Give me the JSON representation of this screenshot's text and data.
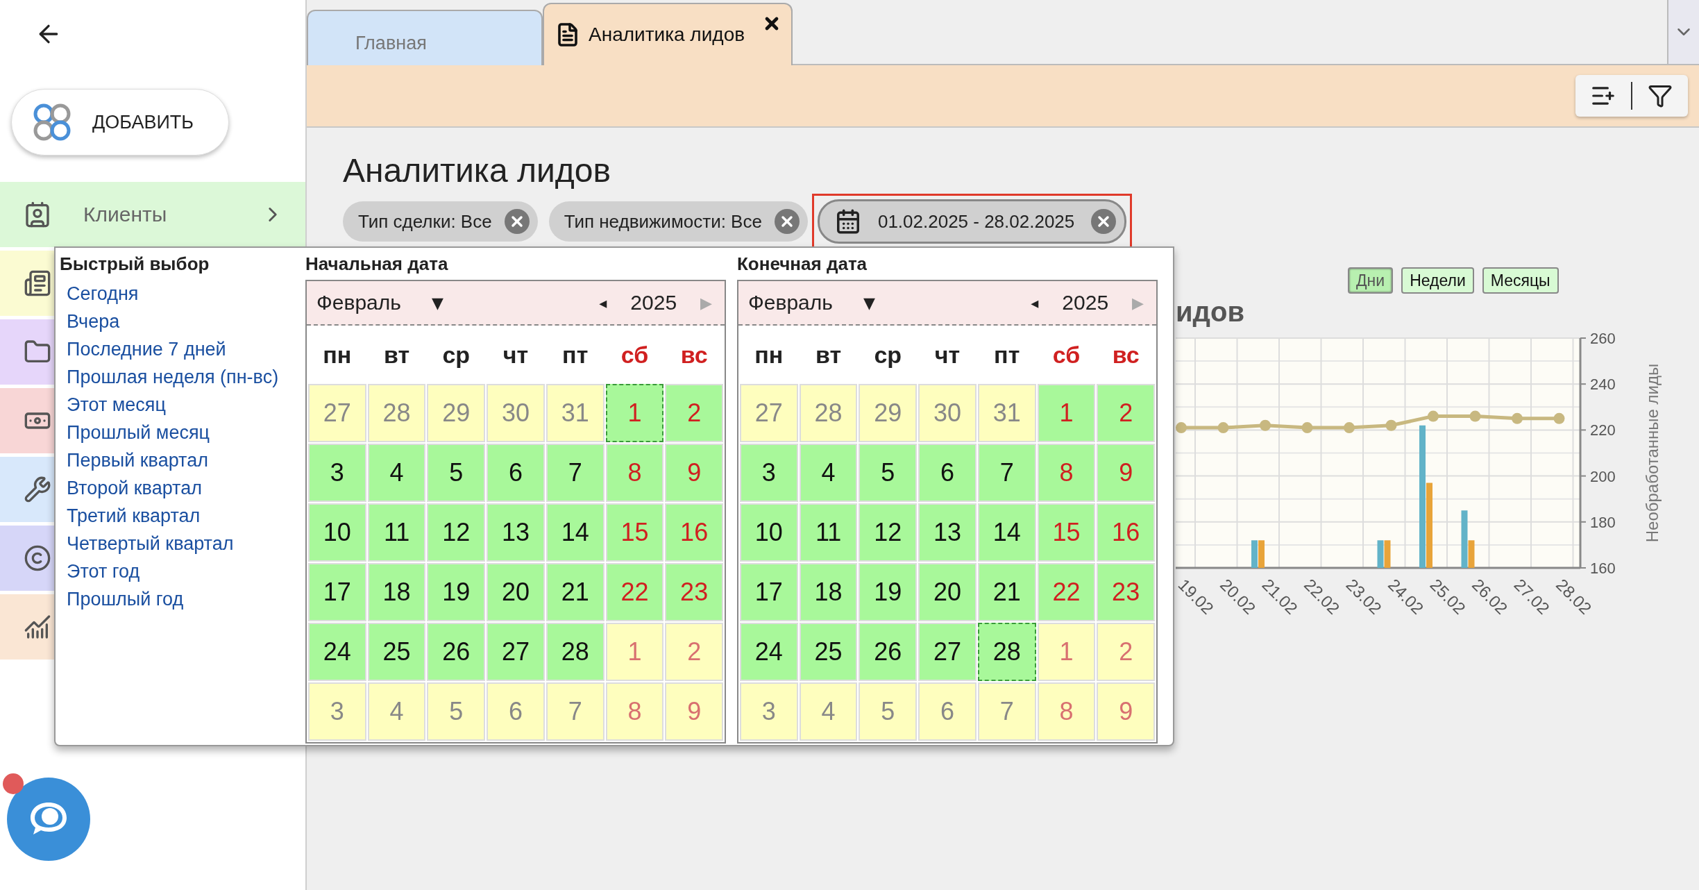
{
  "sidebar": {
    "add_button": "ДОБАВИТЬ",
    "items": [
      {
        "label": "Клиенты",
        "color": "#dcf8d8"
      },
      {
        "color": "#fbfbd2"
      },
      {
        "color": "#e6d6fa"
      },
      {
        "color": "#f8d6d6"
      },
      {
        "color": "#d8e8fb"
      },
      {
        "color": "#d6d6f8"
      },
      {
        "color": "#fae6d4"
      }
    ]
  },
  "tabs": [
    {
      "label": "Главная",
      "selected": false
    },
    {
      "label": "Аналитика лидов",
      "selected": true
    }
  ],
  "page_title": "Аналитика лидов",
  "chips": [
    {
      "kind": "filter",
      "label": "Тип сделки: Все",
      "highlighted": false
    },
    {
      "kind": "filter",
      "label": "Тип недвижимости: Все",
      "highlighted": false
    },
    {
      "kind": "date",
      "label": "01.02.2025 - 28.02.2025",
      "highlighted": true
    }
  ],
  "period_buttons": [
    {
      "label": "Дни",
      "selected": true
    },
    {
      "label": "Недели",
      "selected": false
    },
    {
      "label": "Месяцы",
      "selected": false
    }
  ],
  "chart": {
    "chart_data": {
      "type": "bar",
      "title": "идов",
      "ylabel": "Необработанные лиды",
      "categories": [
        "19.02",
        "20.02",
        "21.02",
        "22.02",
        "23.02",
        "24.02",
        "25.02",
        "26.02",
        "27.02",
        "28.02"
      ],
      "ylim": [
        160,
        260
      ],
      "yticks": [
        160,
        180,
        200,
        220,
        240,
        260
      ],
      "stacked": false,
      "grid": true,
      "series": [
        {
          "color": "#62b3c8",
          "values": [
            null,
            null,
            172,
            null,
            null,
            172,
            222,
            185,
            null,
            null
          ]
        },
        {
          "color": "#e8a43a",
          "values": [
            null,
            null,
            172,
            null,
            null,
            172,
            197,
            172,
            null,
            null
          ]
        },
        {
          "type": "line",
          "marker": "circle",
          "color": "#c8b880",
          "values": [
            221,
            221,
            222,
            221,
            221,
            222,
            226,
            226,
            225,
            225
          ]
        }
      ]
    }
  },
  "picker": {
    "quick_title": "Быстрый выбор",
    "quick_items": [
      "Сегодня",
      "Вчера",
      "Последние 7 дней",
      "Прошлая неделя (пн-вс)",
      "Этот месяц",
      "Прошлый месяц",
      "Первый квартал",
      "Второй квартал",
      "Третий квартал",
      "Четвертый квартал",
      "Этот год",
      "Прошлый год"
    ],
    "calendars": [
      {
        "heading": "Начальная дата",
        "month": "Февраль",
        "month_caret": "▼",
        "prev": "◂",
        "year": "2025",
        "next": "▶",
        "weekdays": [
          {
            "label": "пн",
            "weekend": false
          },
          {
            "label": "вт",
            "weekend": false
          },
          {
            "label": "ср",
            "weekend": false
          },
          {
            "label": "чт",
            "weekend": false
          },
          {
            "label": "пт",
            "weekend": false
          },
          {
            "label": "сб",
            "weekend": true
          },
          {
            "label": "вс",
            "weekend": true
          }
        ],
        "weeks": [
          [
            {
              "label": "27",
              "in_range": false,
              "selected": false
            },
            {
              "label": "28",
              "in_range": false,
              "selected": false
            },
            {
              "label": "29",
              "in_range": false,
              "selected": false
            },
            {
              "label": "30",
              "in_range": false,
              "selected": false
            },
            {
              "label": "31",
              "in_range": false,
              "selected": false
            },
            {
              "label": "1",
              "in_range": true,
              "selected": true
            },
            {
              "label": "2",
              "in_range": true,
              "selected": false
            }
          ],
          [
            {
              "label": "3",
              "in_range": true,
              "selected": false
            },
            {
              "label": "4",
              "in_range": true,
              "selected": false
            },
            {
              "label": "5",
              "in_range": true,
              "selected": false
            },
            {
              "label": "6",
              "in_range": true,
              "selected": false
            },
            {
              "label": "7",
              "in_range": true,
              "selected": false
            },
            {
              "label": "8",
              "in_range": true,
              "selected": false
            },
            {
              "label": "9",
              "in_range": true,
              "selected": false
            }
          ],
          [
            {
              "label": "10",
              "in_range": true,
              "selected": false
            },
            {
              "label": "11",
              "in_range": true,
              "selected": false
            },
            {
              "label": "12",
              "in_range": true,
              "selected": false
            },
            {
              "label": "13",
              "in_range": true,
              "selected": false
            },
            {
              "label": "14",
              "in_range": true,
              "selected": false
            },
            {
              "label": "15",
              "in_range": true,
              "selected": false
            },
            {
              "label": "16",
              "in_range": true,
              "selected": false
            }
          ],
          [
            {
              "label": "17",
              "in_range": true,
              "selected": false
            },
            {
              "label": "18",
              "in_range": true,
              "selected": false
            },
            {
              "label": "19",
              "in_range": true,
              "selected": false
            },
            {
              "label": "20",
              "in_range": true,
              "selected": false
            },
            {
              "label": "21",
              "in_range": true,
              "selected": false
            },
            {
              "label": "22",
              "in_range": true,
              "selected": false
            },
            {
              "label": "23",
              "in_range": true,
              "selected": false
            }
          ],
          [
            {
              "label": "24",
              "in_range": true,
              "selected": false
            },
            {
              "label": "25",
              "in_range": true,
              "selected": false
            },
            {
              "label": "26",
              "in_range": true,
              "selected": false
            },
            {
              "label": "27",
              "in_range": true,
              "selected": false
            },
            {
              "label": "28",
              "in_range": true,
              "selected": false
            },
            {
              "label": "1",
              "in_range": false,
              "selected": false
            },
            {
              "label": "2",
              "in_range": false,
              "selected": false
            }
          ],
          [
            {
              "label": "3",
              "in_range": false,
              "selected": false
            },
            {
              "label": "4",
              "in_range": false,
              "selected": false
            },
            {
              "label": "5",
              "in_range": false,
              "selected": false
            },
            {
              "label": "6",
              "in_range": false,
              "selected": false
            },
            {
              "label": "7",
              "in_range": false,
              "selected": false
            },
            {
              "label": "8",
              "in_range": false,
              "selected": false
            },
            {
              "label": "9",
              "in_range": false,
              "selected": false
            }
          ]
        ]
      },
      {
        "heading": "Конечная дата",
        "month": "Февраль",
        "month_caret": "▼",
        "prev": "◂",
        "year": "2025",
        "next": "▶",
        "weekdays": [
          {
            "label": "пн",
            "weekend": false
          },
          {
            "label": "вт",
            "weekend": false
          },
          {
            "label": "ср",
            "weekend": false
          },
          {
            "label": "чт",
            "weekend": false
          },
          {
            "label": "пт",
            "weekend": false
          },
          {
            "label": "сб",
            "weekend": true
          },
          {
            "label": "вс",
            "weekend": true
          }
        ],
        "weeks": [
          [
            {
              "label": "27",
              "in_range": false,
              "selected": false
            },
            {
              "label": "28",
              "in_range": false,
              "selected": false
            },
            {
              "label": "29",
              "in_range": false,
              "selected": false
            },
            {
              "label": "30",
              "in_range": false,
              "selected": false
            },
            {
              "label": "31",
              "in_range": false,
              "selected": false
            },
            {
              "label": "1",
              "in_range": true,
              "selected": false
            },
            {
              "label": "2",
              "in_range": true,
              "selected": false
            }
          ],
          [
            {
              "label": "3",
              "in_range": true,
              "selected": false
            },
            {
              "label": "4",
              "in_range": true,
              "selected": false
            },
            {
              "label": "5",
              "in_range": true,
              "selected": false
            },
            {
              "label": "6",
              "in_range": true,
              "selected": false
            },
            {
              "label": "7",
              "in_range": true,
              "selected": false
            },
            {
              "label": "8",
              "in_range": true,
              "selected": false
            },
            {
              "label": "9",
              "in_range": true,
              "selected": false
            }
          ],
          [
            {
              "label": "10",
              "in_range": true,
              "selected": false
            },
            {
              "label": "11",
              "in_range": true,
              "selected": false
            },
            {
              "label": "12",
              "in_range": true,
              "selected": false
            },
            {
              "label": "13",
              "in_range": true,
              "selected": false
            },
            {
              "label": "14",
              "in_range": true,
              "selected": false
            },
            {
              "label": "15",
              "in_range": true,
              "selected": false
            },
            {
              "label": "16",
              "in_range": true,
              "selected": false
            }
          ],
          [
            {
              "label": "17",
              "in_range": true,
              "selected": false
            },
            {
              "label": "18",
              "in_range": true,
              "selected": false
            },
            {
              "label": "19",
              "in_range": true,
              "selected": false
            },
            {
              "label": "20",
              "in_range": true,
              "selected": false
            },
            {
              "label": "21",
              "in_range": true,
              "selected": false
            },
            {
              "label": "22",
              "in_range": true,
              "selected": false
            },
            {
              "label": "23",
              "in_range": true,
              "selected": false
            }
          ],
          [
            {
              "label": "24",
              "in_range": true,
              "selected": false
            },
            {
              "label": "25",
              "in_range": true,
              "selected": false
            },
            {
              "label": "26",
              "in_range": true,
              "selected": false
            },
            {
              "label": "27",
              "in_range": true,
              "selected": false
            },
            {
              "label": "28",
              "in_range": true,
              "selected": true
            },
            {
              "label": "1",
              "in_range": false,
              "selected": false
            },
            {
              "label": "2",
              "in_range": false,
              "selected": false
            }
          ],
          [
            {
              "label": "3",
              "in_range": false,
              "selected": false
            },
            {
              "label": "4",
              "in_range": false,
              "selected": false
            },
            {
              "label": "5",
              "in_range": false,
              "selected": false
            },
            {
              "label": "6",
              "in_range": false,
              "selected": false
            },
            {
              "label": "7",
              "in_range": false,
              "selected": false
            },
            {
              "label": "8",
              "in_range": false,
              "selected": false
            },
            {
              "label": "9",
              "in_range": false,
              "selected": false
            }
          ]
        ]
      }
    ]
  }
}
